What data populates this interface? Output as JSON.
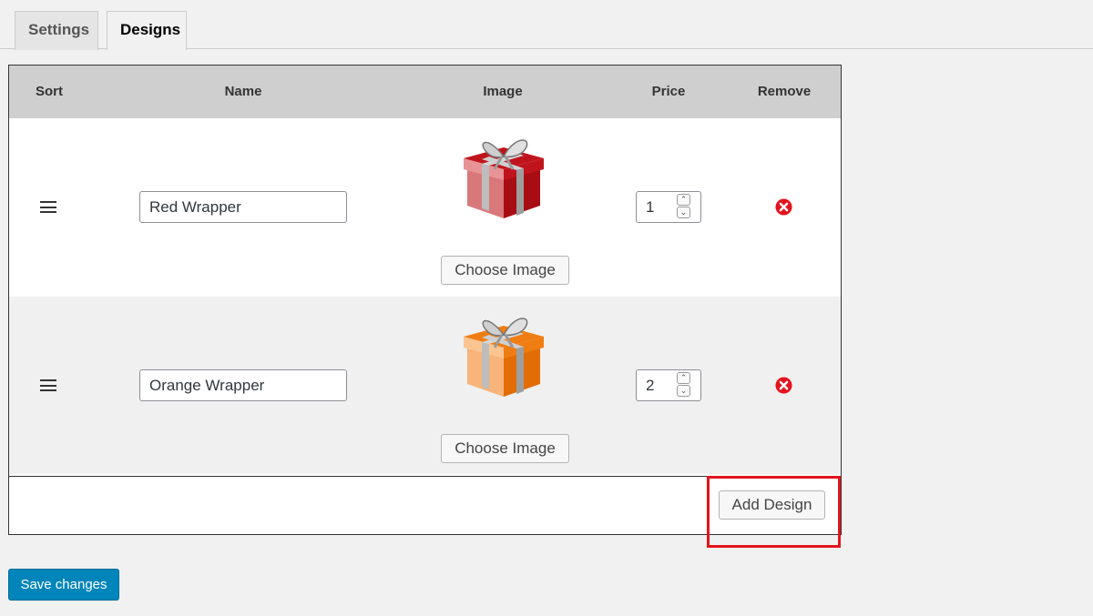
{
  "tabs": [
    {
      "label": "Settings",
      "active": false
    },
    {
      "label": "Designs",
      "active": true
    }
  ],
  "table": {
    "headers": {
      "sort": "Sort",
      "name": "Name",
      "image": "Image",
      "price": "Price",
      "remove": "Remove"
    },
    "rows": [
      {
        "name": "Red Wrapper",
        "image_icon": "gift-box-red-icon",
        "choose_label": "Choose Image",
        "price": "1",
        "box_color": "#c0141c",
        "box_light": "#d9787b"
      },
      {
        "name": "Orange Wrapper",
        "image_icon": "gift-box-orange-icon",
        "choose_label": "Choose Image",
        "price": "2",
        "box_color": "#f07d12",
        "box_light": "#f8b47a"
      }
    ],
    "add_label": "Add Design"
  },
  "save_label": "Save changes",
  "colors": {
    "accent": "#0085ba",
    "remove": "#e3141c",
    "highlight": "#e3141c"
  }
}
